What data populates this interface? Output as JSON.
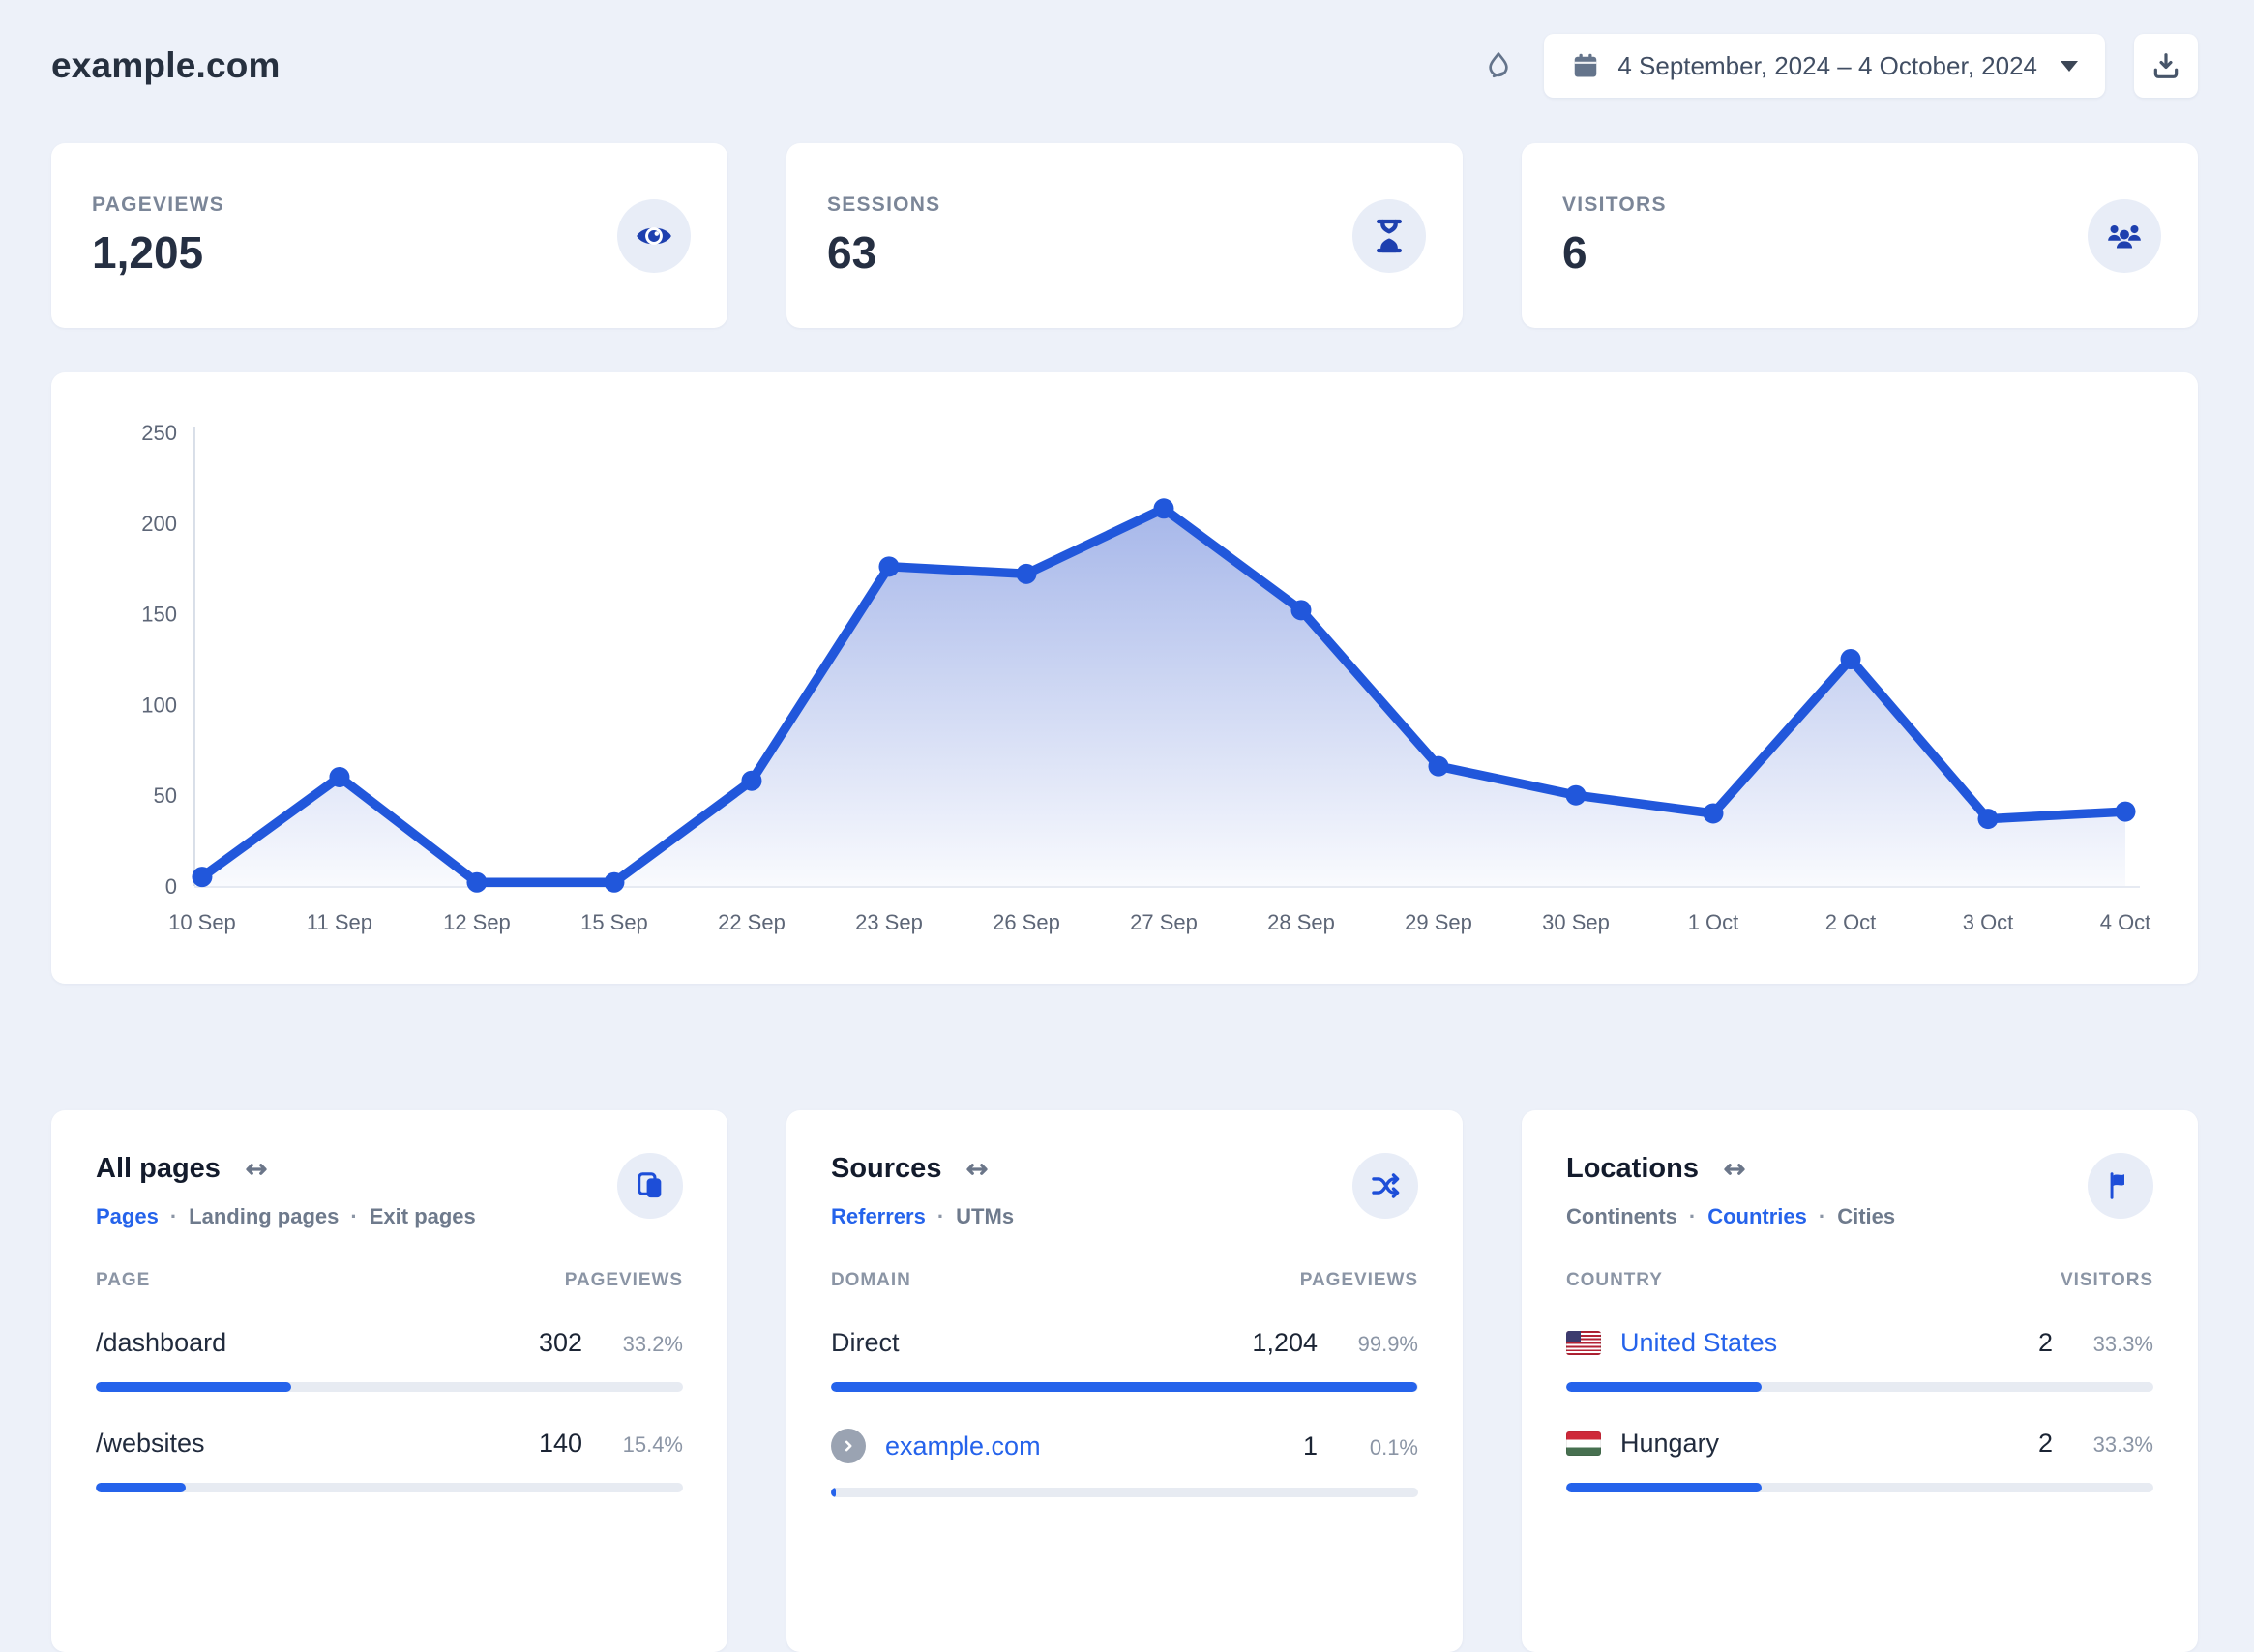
{
  "ui": {
    "dot": "·"
  },
  "header": {
    "site_title": "example.com",
    "date_range": "4 September, 2024 – 4 October, 2024",
    "icons": [
      "eraser-icon",
      "calendar-icon",
      "caret-down-icon",
      "download-icon"
    ]
  },
  "stats": [
    {
      "label": "PAGEVIEWS",
      "value": "1,205",
      "icon": "eye-icon"
    },
    {
      "label": "SESSIONS",
      "value": "63",
      "icon": "hourglass-icon"
    },
    {
      "label": "VISITORS",
      "value": "6",
      "icon": "users-icon"
    }
  ],
  "chart_data": {
    "type": "area",
    "x": [
      "10 Sep",
      "11 Sep",
      "12 Sep",
      "15 Sep",
      "22 Sep",
      "23 Sep",
      "26 Sep",
      "27 Sep",
      "28 Sep",
      "29 Sep",
      "30 Sep",
      "1 Oct",
      "2 Oct",
      "3 Oct",
      "4 Oct"
    ],
    "values": [
      5,
      60,
      2,
      2,
      58,
      176,
      172,
      208,
      152,
      66,
      50,
      40,
      125,
      37,
      41
    ],
    "ylim": [
      0,
      250
    ],
    "yticks": [
      0,
      50,
      100,
      150,
      200,
      250
    ],
    "grid": false,
    "legend": false,
    "line_color": "#2157db",
    "marker_color": "#2157db",
    "fill_top": "rgba(62,98,208,0.46)",
    "fill_bottom": "rgba(62,98,208,0.03)"
  },
  "panels": [
    {
      "title": "All pages",
      "icon": "pages-copy-icon",
      "tabs": [
        {
          "label": "Pages",
          "active": true
        },
        {
          "label": "Landing pages",
          "active": false
        },
        {
          "label": "Exit pages",
          "active": false
        }
      ],
      "columns": [
        "PAGE",
        "PAGEVIEWS"
      ],
      "rows": [
        {
          "name": "/dashboard",
          "value": "302",
          "percent": "33.2%",
          "bar_percent": 33.2
        },
        {
          "name": "/websites",
          "value": "140",
          "percent": "15.4%",
          "bar_percent": 15.4
        }
      ]
    },
    {
      "title": "Sources",
      "icon": "shuffle-icon",
      "tabs": [
        {
          "label": "Referrers",
          "active": true
        },
        {
          "label": "UTMs",
          "active": false
        }
      ],
      "columns": [
        "DOMAIN",
        "PAGEVIEWS"
      ],
      "rows": [
        {
          "name": "Direct",
          "value": "1,204",
          "percent": "99.9%",
          "bar_percent": 99.9
        },
        {
          "name": "example.com",
          "value": "1",
          "percent": "0.1%",
          "bar_percent": 0.8
        }
      ]
    },
    {
      "title": "Locations",
      "icon": "flag-icon",
      "tabs": [
        {
          "label": "Continents",
          "active": false
        },
        {
          "label": "Countries",
          "active": true
        },
        {
          "label": "Cities",
          "active": false
        }
      ],
      "columns": [
        "COUNTRY",
        "VISITORS"
      ],
      "rows": [
        {
          "name": "United States",
          "value": "2",
          "percent": "33.3%",
          "bar_percent": 33.3,
          "flag": "us-flag-icon"
        },
        {
          "name": "Hungary",
          "value": "2",
          "percent": "33.3%",
          "bar_percent": 33.3,
          "flag": "hungary-flag-icon"
        }
      ]
    }
  ]
}
